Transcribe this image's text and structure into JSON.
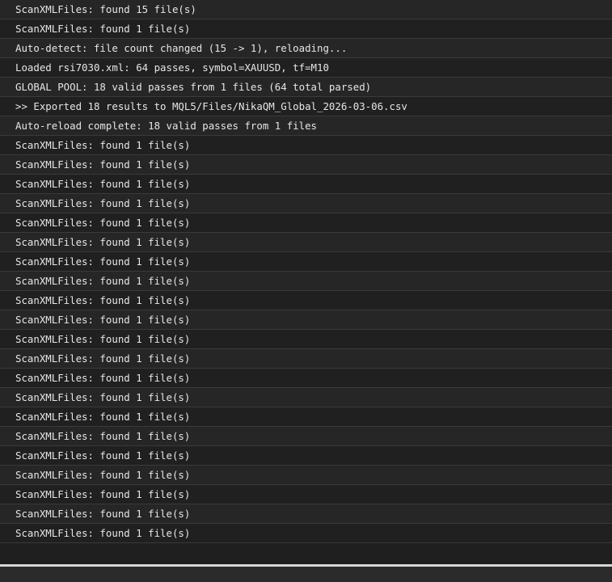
{
  "log": {
    "entries": [
      "ScanXMLFiles: found 15 file(s)",
      "ScanXMLFiles: found 1 file(s)",
      "Auto-detect: file count changed (15 -> 1), reloading...",
      "Loaded rsi7030.xml: 64 passes, symbol=XAUUSD, tf=M10",
      "GLOBAL POOL: 18 valid passes from 1 files (64 total parsed)",
      ">> Exported 18 results to MQL5/Files/NikaQM_Global_2026-03-06.csv",
      "Auto-reload complete: 18 valid passes from 1 files",
      "ScanXMLFiles: found 1 file(s)",
      "ScanXMLFiles: found 1 file(s)",
      "ScanXMLFiles: found 1 file(s)",
      "ScanXMLFiles: found 1 file(s)",
      "ScanXMLFiles: found 1 file(s)",
      "ScanXMLFiles: found 1 file(s)",
      "ScanXMLFiles: found 1 file(s)",
      "ScanXMLFiles: found 1 file(s)",
      "ScanXMLFiles: found 1 file(s)",
      "ScanXMLFiles: found 1 file(s)",
      "ScanXMLFiles: found 1 file(s)",
      "ScanXMLFiles: found 1 file(s)",
      "ScanXMLFiles: found 1 file(s)",
      "ScanXMLFiles: found 1 file(s)",
      "ScanXMLFiles: found 1 file(s)",
      "ScanXMLFiles: found 1 file(s)",
      "ScanXMLFiles: found 1 file(s)",
      "ScanXMLFiles: found 1 file(s)",
      "ScanXMLFiles: found 1 file(s)",
      "ScanXMLFiles: found 1 file(s)",
      "ScanXMLFiles: found 1 file(s)"
    ]
  }
}
